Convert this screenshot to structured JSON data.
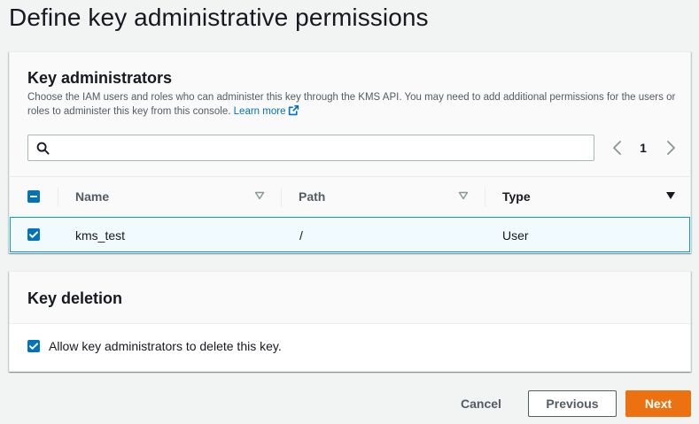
{
  "page": {
    "title": "Define key administrative permissions"
  },
  "key_administrators": {
    "heading": "Key administrators",
    "description": "Choose the IAM users and roles who can administer this key through the KMS API. You may need to add additional permissions for the users or roles to administer this key from this console.",
    "learn_more_label": "Learn more",
    "search": {
      "value": "",
      "placeholder": ""
    },
    "pagination": {
      "current_page": "1"
    },
    "table": {
      "columns": [
        "Name",
        "Path",
        "Type"
      ],
      "rows": [
        {
          "selected": true,
          "name": "kms_test",
          "path": "/",
          "type": "User"
        }
      ],
      "header_checkbox_state": "indeterminate"
    }
  },
  "key_deletion": {
    "heading": "Key deletion",
    "allow_delete_label": "Allow key administrators to delete this key.",
    "allow_delete_checked": true
  },
  "footer": {
    "cancel_label": "Cancel",
    "previous_label": "Previous",
    "next_label": "Next"
  },
  "colors": {
    "accent": "#0073bb",
    "primary_button": "#ec7211",
    "selected_row_bg": "#f1faff",
    "selected_row_border": "#00a1c9"
  }
}
